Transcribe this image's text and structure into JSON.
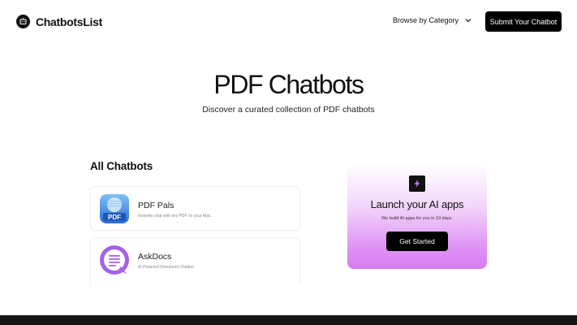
{
  "header": {
    "logo_text": "ChatbotsList",
    "browse_label": "Browse by Category",
    "submit_label": "Submit Your Chatbot"
  },
  "hero": {
    "title": "PDF Chatbots",
    "subtitle": "Discover a curated collection of PDF chatbots"
  },
  "listing": {
    "section_title": "All Chatbots",
    "items": [
      {
        "name": "PDF Pals",
        "description": "Instantly chat with any PDF on your Mac.",
        "thumb_label": "PDF"
      },
      {
        "name": "AskDocs",
        "description": "AI Powered Document Chatbot"
      }
    ]
  },
  "promo": {
    "title": "Launch your AI apps",
    "subtitle": "We build AI apps for you in 10 days.",
    "button_label": "Get Started"
  },
  "colors": {
    "primary": "#000000",
    "promo_gradient_end": "#d77af2",
    "askdocs_purple": "#a560e8",
    "pdfpals_blue": "#3a7fd9"
  }
}
